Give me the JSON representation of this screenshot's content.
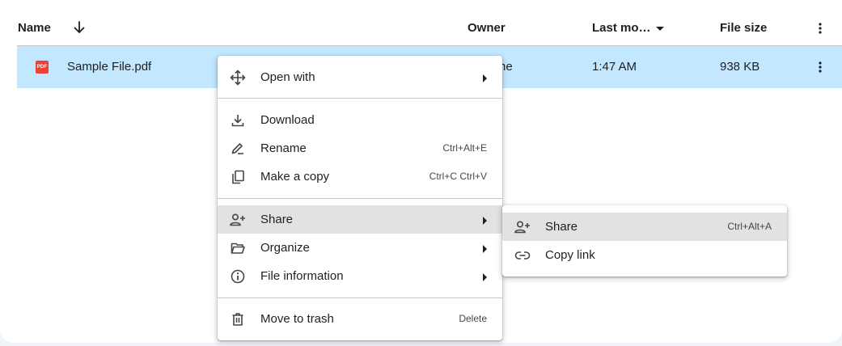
{
  "header": {
    "name": "Name",
    "owner": "Owner",
    "last_modified": "Last mo…",
    "file_size": "File size"
  },
  "file_row": {
    "icon_label": "PDF",
    "name": "Sample File.pdf",
    "owner_partial": "ne",
    "modified": "1:47 AM",
    "size": "938 KB"
  },
  "context_menu": {
    "open_with": "Open with",
    "download": "Download",
    "rename": "Rename",
    "rename_shortcut": "Ctrl+Alt+E",
    "make_copy": "Make a copy",
    "make_copy_shortcut": "Ctrl+C Ctrl+V",
    "share": "Share",
    "organize": "Organize",
    "file_information": "File information",
    "move_to_trash": "Move to trash",
    "move_to_trash_shortcut": "Delete"
  },
  "share_submenu": {
    "share": "Share",
    "share_shortcut": "Ctrl+Alt+A",
    "copy_link": "Copy link"
  },
  "colors": {
    "selected_row": "#c2e7ff",
    "hover_item": "#e2e2e2",
    "pdf_red": "#ea4335"
  },
  "icons": {
    "sort": "arrow-down-icon",
    "more": "more-vert-icon",
    "open_with": "open-with-icon",
    "download": "download-icon",
    "rename": "edit-icon",
    "make_copy": "copy-icon",
    "share": "person-add-icon",
    "organize": "folder-open-icon",
    "file_information": "info-icon",
    "move_to_trash": "trash-icon",
    "copy_link": "link-icon"
  }
}
